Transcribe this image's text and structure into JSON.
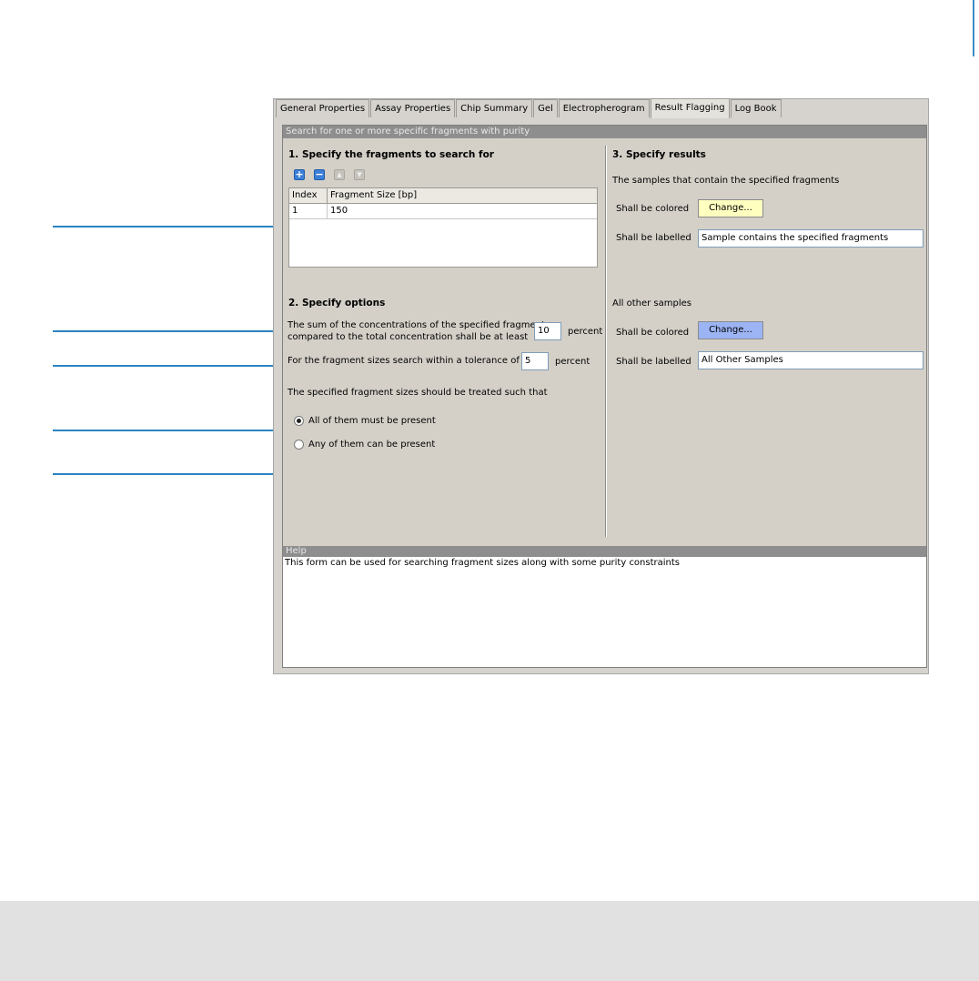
{
  "tabs": [
    {
      "label": "General Properties"
    },
    {
      "label": "Assay Properties"
    },
    {
      "label": "Chip Summary"
    },
    {
      "label": "Gel"
    },
    {
      "label": "Electropherogram"
    },
    {
      "label": "Result Flagging",
      "active": true
    },
    {
      "label": "Log Book"
    }
  ],
  "panel": {
    "title": "Search for one or more specific fragments with purity"
  },
  "section1": {
    "heading": "1. Specify the fragments to search for",
    "toolbar_icons": [
      "add-icon",
      "remove-icon",
      "move-up-icon",
      "move-down-icon"
    ],
    "table": {
      "columns": [
        "Index",
        "Fragment Size [bp]"
      ],
      "rows": [
        [
          "1",
          "150"
        ]
      ]
    }
  },
  "section2": {
    "heading": "2. Specify options",
    "sum_line1": "The sum of the concentrations of the specified fragments",
    "sum_line2": "compared to the total concentration shall be at least",
    "sum_value": "10",
    "sum_unit": "percent",
    "tolerance_label": "For the fragment sizes search within a tolerance of ±",
    "tolerance_value": "5",
    "tolerance_unit": "percent",
    "treat_label": "The specified fragment sizes should be treated such that",
    "radio_all": "All of them must be present",
    "radio_any": "Any of them can be present",
    "selected_radio": "All of them must be present"
  },
  "section3": {
    "heading": "3. Specify results",
    "match_label": "The samples that contain the specified fragments",
    "colored_label": "Shall be colored",
    "change_label": "Change...",
    "labelled_label": "Shall be labelled",
    "match_text": "Sample contains the specified fragments",
    "match_color": "#ffffc0",
    "other_label": "All other samples",
    "other_text": "All Other Samples",
    "other_color": "#9cb4f4"
  },
  "help": {
    "title": "Help",
    "text": "This form can be used for searching fragment sizes along with some purity constraints"
  }
}
